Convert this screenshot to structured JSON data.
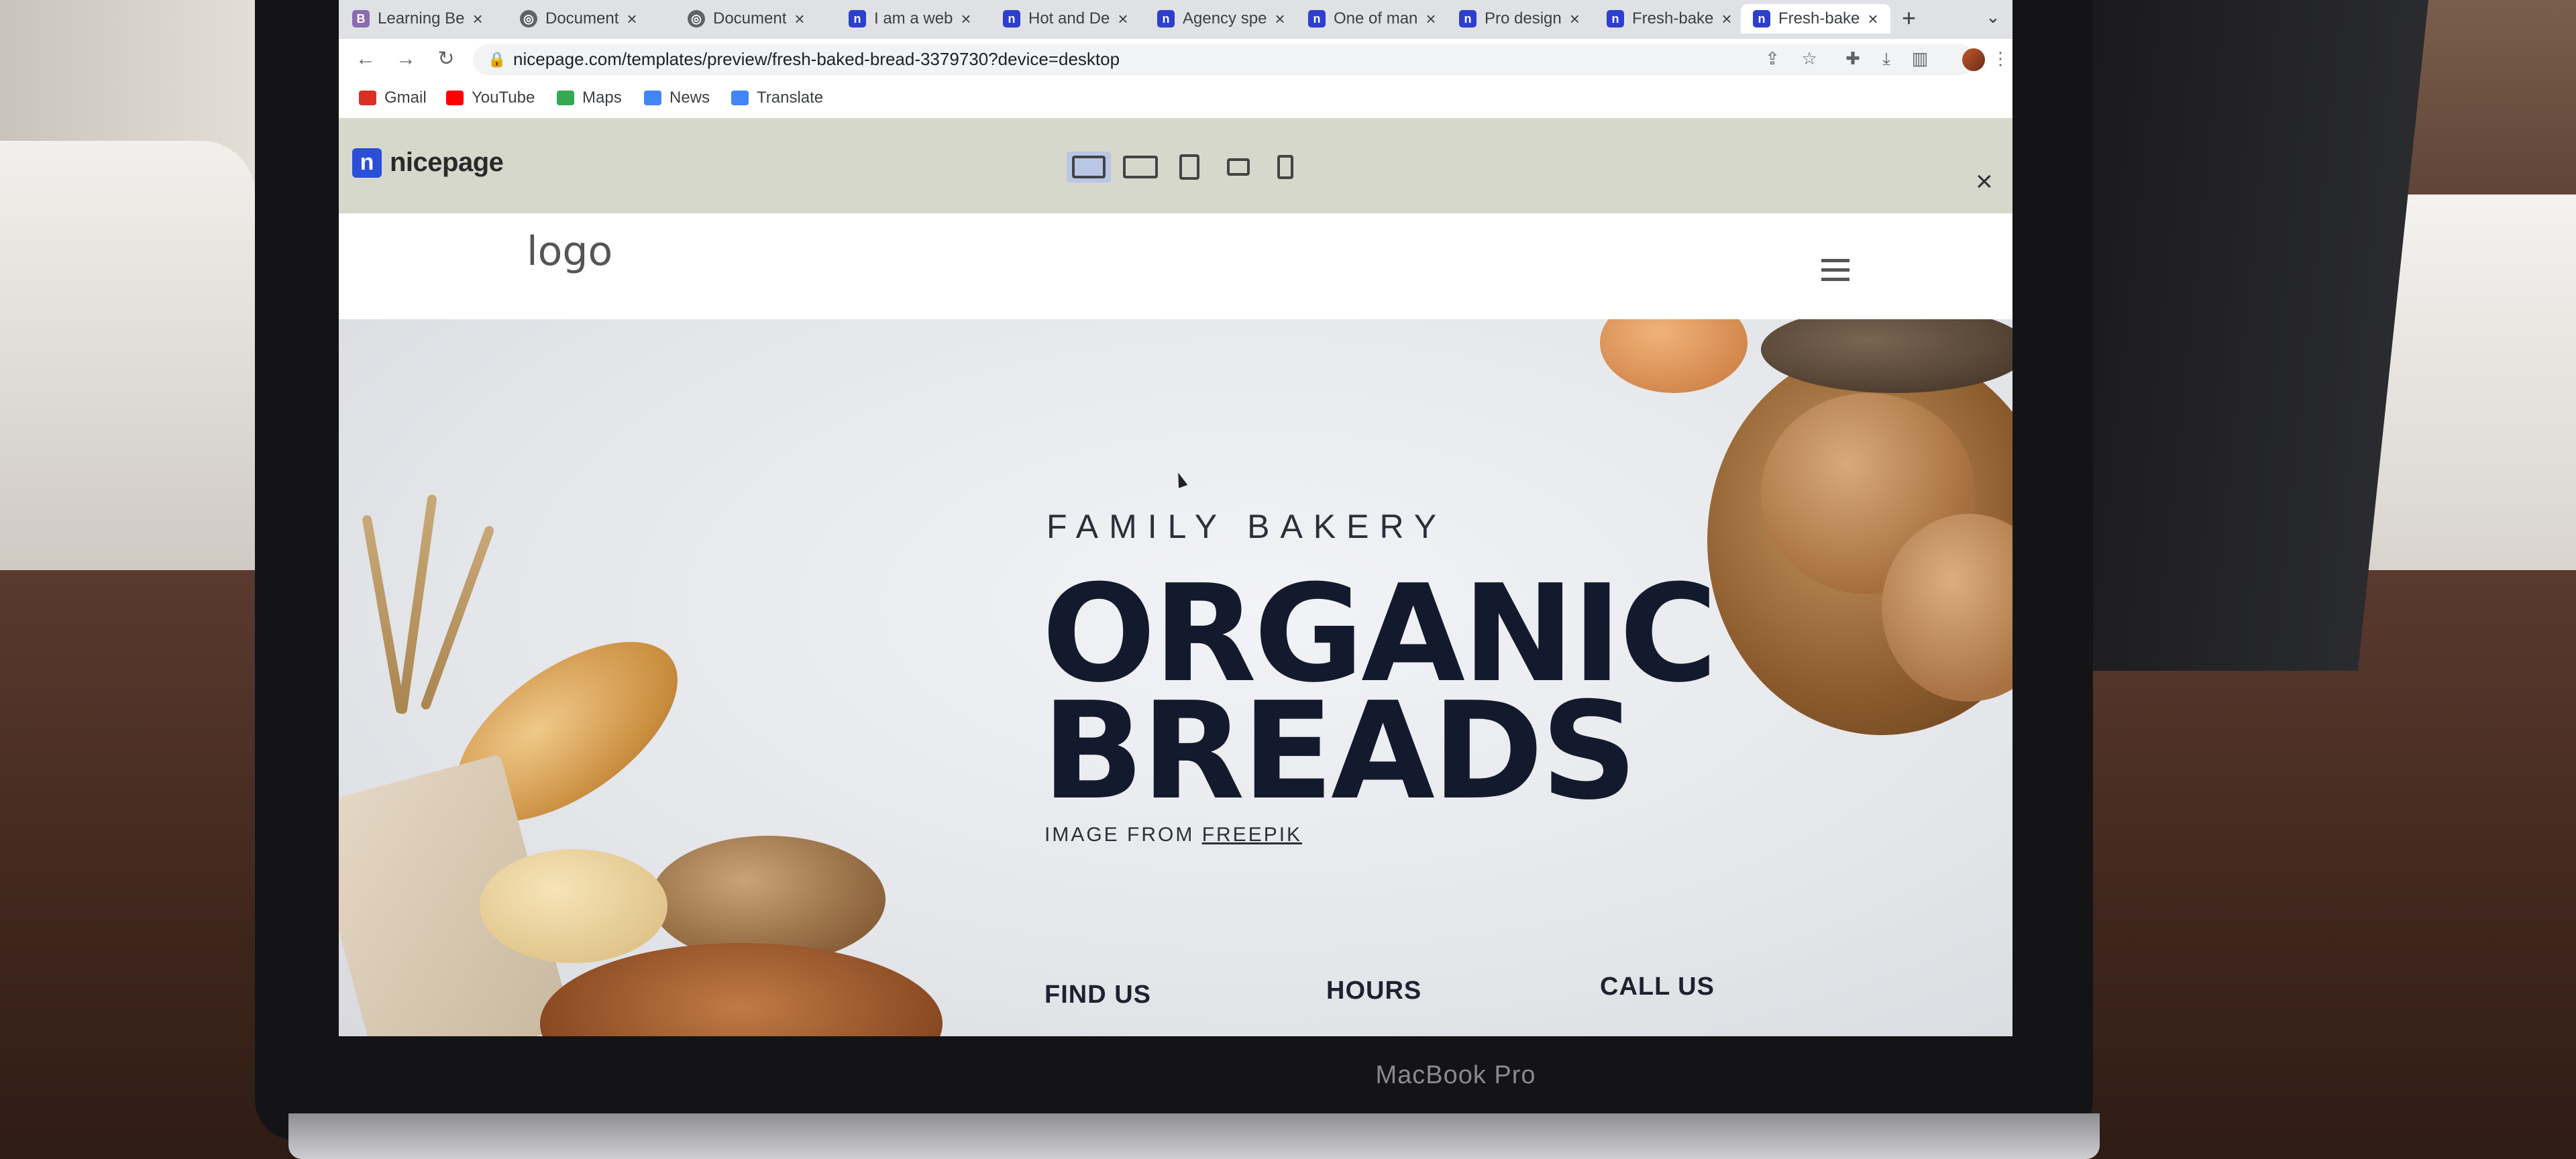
{
  "browser": {
    "tabs": [
      {
        "label": "Learning Be",
        "icon": "book-icon"
      },
      {
        "label": "Document",
        "icon": "globe-icon"
      },
      {
        "label": "Document",
        "icon": "globe-icon"
      },
      {
        "label": "I am a web",
        "icon": "nicepage-icon"
      },
      {
        "label": "Hot and De",
        "icon": "nicepage-icon"
      },
      {
        "label": "Agency spe",
        "icon": "nicepage-icon"
      },
      {
        "label": "One of man",
        "icon": "nicepage-icon"
      },
      {
        "label": "Pro design",
        "icon": "nicepage-icon"
      },
      {
        "label": "Fresh-bake",
        "icon": "nicepage-icon"
      },
      {
        "label": "Fresh-bake",
        "icon": "nicepage-icon",
        "active": true
      }
    ],
    "new_tab": "+",
    "url": "nicepage.com/templates/preview/fresh-baked-bread-3379730?device=desktop",
    "bookmarks": [
      {
        "label": "Gmail",
        "color": "#d93025"
      },
      {
        "label": "YouTube",
        "color": "#ff0000"
      },
      {
        "label": "Maps",
        "color": "#34a853"
      },
      {
        "label": "News",
        "color": "#4285f4"
      },
      {
        "label": "Translate",
        "color": "#4285f4"
      }
    ]
  },
  "nicepage": {
    "brand": "nicepage",
    "devices": [
      "desktop",
      "laptop",
      "tablet",
      "tablet-landscape",
      "phone"
    ],
    "selected_device": "desktop",
    "close": "×"
  },
  "site": {
    "logo": "logo",
    "hero": {
      "kicker": "FAMILY BAKERY",
      "title_line1": "ORGANIC",
      "title_line2": "BREADS",
      "credit_prefix": "IMAGE FROM",
      "credit_link": "FREEPIK"
    },
    "footer_headings": [
      "FIND US",
      "HOURS",
      "CALL US"
    ]
  },
  "device_label": "MacBook Pro",
  "colors": {
    "title": "#141a2e",
    "nicepage_accent": "#2b4fd8",
    "preview_bar": "#d6d8cb"
  }
}
